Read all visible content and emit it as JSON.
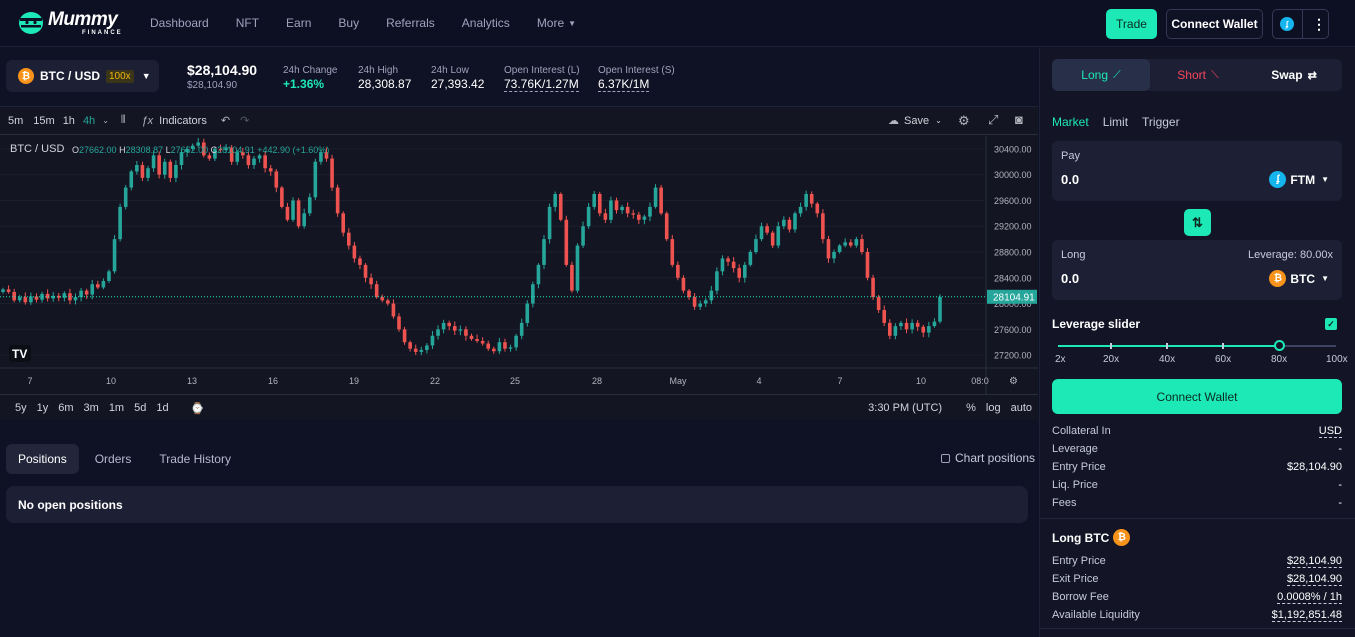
{
  "brand": {
    "name": "Mummy",
    "sub": "FINANCE"
  },
  "nav": [
    "Dashboard",
    "NFT",
    "Earn",
    "Buy",
    "Referrals",
    "Analytics",
    "More"
  ],
  "header": {
    "trade_label": "Trade",
    "connect_label": "Connect Wallet",
    "network_icon": "fantom-icon"
  },
  "ticker": {
    "pair": "BTC / USD",
    "leverage_badge": "100x",
    "price": "$28,104.90",
    "price_sub": "$28,104.90",
    "stats": [
      {
        "label": "24h Change",
        "value": "+1.36%",
        "style": "green"
      },
      {
        "label": "24h High",
        "value": "28,308.87",
        "style": ""
      },
      {
        "label": "24h Low",
        "value": "27,393.42",
        "style": ""
      },
      {
        "label": "Open Interest (L)",
        "value": "73.76K/1.27M",
        "style": "dash"
      },
      {
        "label": "Open Interest (S)",
        "value": "6.37K/1M",
        "style": "dash"
      }
    ]
  },
  "chart_toolbar": {
    "timeframes": [
      "5m",
      "15m",
      "1h",
      "4h"
    ],
    "active_timeframe": "4h",
    "indicators_label": "Indicators",
    "save_label": "Save"
  },
  "chart_data": {
    "type": "candlestick",
    "symbol": "BTC / USD",
    "ohlc_text": {
      "o": "27662.00",
      "h": "28308.87",
      "l": "27662.00",
      "c": "28104.91",
      "change": "+442.90 (+1.60%)"
    },
    "last_price_label": "28104.91",
    "last_price": 28104.91,
    "ylim": [
      27000,
      30600
    ],
    "y_ticks": [
      "30400.00",
      "30000.00",
      "29600.00",
      "29200.00",
      "28800.00",
      "28400.00",
      "28000.00",
      "27600.00",
      "27200.00"
    ],
    "x_ticks": [
      "7",
      "10",
      "13",
      "16",
      "19",
      "22",
      "25",
      "28",
      "May",
      "4",
      "7",
      "10",
      "08:0"
    ],
    "closes": [
      28220,
      28180,
      28050,
      28100,
      28020,
      28110,
      28060,
      28150,
      28080,
      28120,
      28090,
      28160,
      28050,
      28100,
      28200,
      28140,
      28300,
      28250,
      28350,
      28500,
      29000,
      29500,
      29800,
      30050,
      30150,
      29950,
      30100,
      30300,
      30000,
      30200,
      29950,
      30150,
      30350,
      30400,
      30450,
      30500,
      30300,
      30250,
      30400,
      30380,
      30420,
      30200,
      30350,
      30300,
      30150,
      30250,
      30300,
      30100,
      30050,
      29800,
      29500,
      29300,
      29600,
      29200,
      29400,
      29650,
      30200,
      30350,
      30250,
      29800,
      29400,
      29100,
      28900,
      28700,
      28600,
      28400,
      28300,
      28100,
      28050,
      28000,
      27800,
      27600,
      27400,
      27300,
      27250,
      27280,
      27350,
      27500,
      27600,
      27700,
      27650,
      27580,
      27600,
      27500,
      27450,
      27420,
      27380,
      27300,
      27260,
      27400,
      27300,
      27320,
      27500,
      27700,
      28000,
      28300,
      28600,
      29000,
      29500,
      29700,
      29300,
      28600,
      28200,
      28900,
      29200,
      29500,
      29700,
      29400,
      29300,
      29600,
      29450,
      29500,
      29400,
      29380,
      29300,
      29350,
      29500,
      29800,
      29400,
      29000,
      28600,
      28400,
      28200,
      28100,
      27950,
      28000,
      28050,
      28200,
      28500,
      28700,
      28650,
      28550,
      28400,
      28600,
      28800,
      29000,
      29200,
      29100,
      28900,
      29200,
      29300,
      29150,
      29400,
      29500,
      29700,
      29550,
      29400,
      29000,
      28700,
      28800,
      28900,
      28950,
      28900,
      29000,
      28800,
      28400,
      28100,
      27900,
      27700,
      27500,
      27650,
      27700,
      27600,
      27700,
      27640,
      27550,
      27650,
      27720,
      28104
    ]
  },
  "chart_bottom": {
    "ranges": [
      "5y",
      "1y",
      "6m",
      "3m",
      "1m",
      "5d",
      "1d"
    ],
    "time": "3:30 PM (UTC)",
    "pct": "%",
    "log": "log",
    "auto": "auto"
  },
  "tabs": [
    "Positions",
    "Orders",
    "Trade History"
  ],
  "chart_positions_label": "Chart positions",
  "no_positions": "No open positions",
  "panel": {
    "tabs": {
      "long": "Long",
      "short": "Short",
      "swap": "Swap"
    },
    "order_types": [
      "Market",
      "Limit",
      "Trigger"
    ],
    "pay": {
      "label": "Pay",
      "value": "0.0",
      "token": "FTM"
    },
    "long": {
      "label": "Long",
      "leverage": "Leverage: 80.00x",
      "value": "0.0",
      "token": "BTC"
    },
    "leverage_slider_label": "Leverage slider",
    "slider_value": 80,
    "slider_marks": [
      "2x",
      "20x",
      "40x",
      "60x",
      "80x",
      "100x"
    ],
    "connect_label": "Connect Wallet",
    "info": [
      {
        "k": "Collateral In",
        "v": "USD",
        "u": true
      },
      {
        "k": "Leverage",
        "v": "-",
        "u": false
      },
      {
        "k": "Entry Price",
        "v": "$28,104.90",
        "u": false
      },
      {
        "k": "Liq. Price",
        "v": "-",
        "u": false
      },
      {
        "k": "Fees",
        "v": "-",
        "u": false
      }
    ],
    "long_btc_title": "Long BTC",
    "long_info": [
      {
        "k": "Entry Price",
        "v": "$28,104.90"
      },
      {
        "k": "Exit Price",
        "v": "$28,104.90"
      },
      {
        "k": "Borrow Fee",
        "v": "0.0008% / 1h"
      },
      {
        "k": "Available Liquidity",
        "v": "$1,192,851.48"
      }
    ]
  }
}
